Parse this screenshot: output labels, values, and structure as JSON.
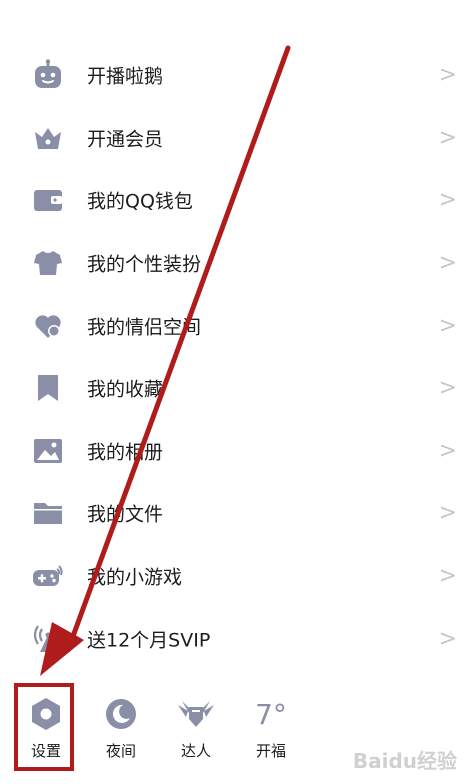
{
  "menu": {
    "items": [
      {
        "label": "开播啦鹅",
        "icon": "robot-icon"
      },
      {
        "label": "开通会员",
        "icon": "crown-icon"
      },
      {
        "label": "我的QQ钱包",
        "icon": "wallet-icon"
      },
      {
        "label": "我的个性装扮",
        "icon": "tshirt-icon"
      },
      {
        "label": "我的情侣空间",
        "icon": "heart-icon"
      },
      {
        "label": "我的收藏",
        "icon": "bookmark-icon"
      },
      {
        "label": "我的相册",
        "icon": "image-icon"
      },
      {
        "label": "我的文件",
        "icon": "folder-icon"
      },
      {
        "label": "我的小游戏",
        "icon": "gamepad-icon"
      },
      {
        "label": "送12个月SVIP",
        "icon": "signal-tower-icon"
      }
    ],
    "chevron": ">"
  },
  "bottom_bar": {
    "settings": {
      "label": "设置",
      "icon": "hexagon-gear-icon"
    },
    "night": {
      "label": "夜间",
      "icon": "moon-icon"
    },
    "expert": {
      "label": "达人",
      "icon": "winged-badge-icon"
    },
    "weather": {
      "label": "开福",
      "temp": "7°"
    }
  },
  "watermark": "Baidu经验",
  "colors": {
    "icon": "#8a8ea6",
    "text": "#1d1d1d",
    "chevron": "#c6c6cc",
    "annotation": "#b01c1c"
  }
}
